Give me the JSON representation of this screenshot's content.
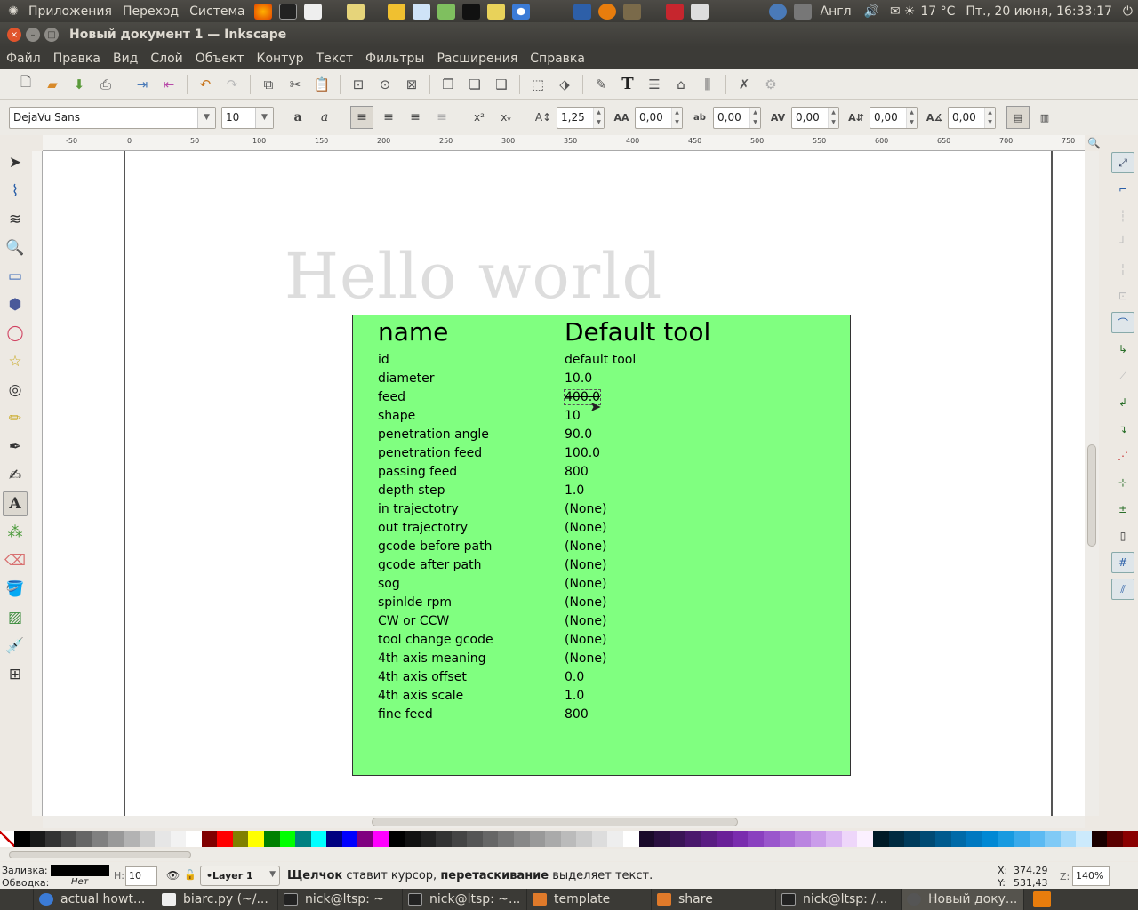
{
  "topbar": {
    "menus": [
      "Приложения",
      "Переход",
      "Система"
    ],
    "keyboard_layout": "Англ",
    "weather": "17 °C",
    "datetime": "Пт., 20 июня, 16:33:17"
  },
  "window": {
    "title": "Новый документ 1 — Inkscape"
  },
  "menubar": [
    "Файл",
    "Правка",
    "Вид",
    "Слой",
    "Объект",
    "Контур",
    "Текст",
    "Фильтры",
    "Расширения",
    "Справка"
  ],
  "textbar": {
    "font_family": "DejaVu Sans",
    "font_size": "10",
    "line_spacing": "1,25",
    "letter_spacing": "0,00",
    "word_spacing": "0,00",
    "kern_h": "0,00",
    "kern_v": "0,00",
    "rotation": "0,00"
  },
  "ruler_labels": [
    "-50",
    "0",
    "50",
    "100",
    "150",
    "200",
    "250",
    "300",
    "350",
    "400",
    "450",
    "500",
    "550",
    "600",
    "650",
    "700",
    "750"
  ],
  "canvas": {
    "hello_text": "Hello  world",
    "table_header_key": "name",
    "table_header_value": "Default tool",
    "rows": [
      {
        "k": "id",
        "v": "default tool"
      },
      {
        "k": "diameter",
        "v": "10.0"
      },
      {
        "k": "feed",
        "v": "400.0"
      },
      {
        "k": "shape",
        "v": "10"
      },
      {
        "k": "penetration angle",
        "v": "90.0"
      },
      {
        "k": "penetration feed",
        "v": "100.0"
      },
      {
        "k": "passing feed",
        "v": "800"
      },
      {
        "k": "depth step",
        "v": "1.0"
      },
      {
        "k": "in trajectotry",
        "v": "(None)"
      },
      {
        "k": "out trajectotry",
        "v": "(None)"
      },
      {
        "k": "gcode before path",
        "v": "(None)"
      },
      {
        "k": "gcode after path",
        "v": "(None)"
      },
      {
        "k": "sog",
        "v": "(None)"
      },
      {
        "k": "spinlde rpm",
        "v": "(None)"
      },
      {
        "k": "CW or CCW",
        "v": "(None)"
      },
      {
        "k": "tool change gcode",
        "v": "(None)"
      },
      {
        "k": "4th axis meaning",
        "v": "(None)"
      },
      {
        "k": "4th axis offset",
        "v": "0.0"
      },
      {
        "k": "4th axis scale",
        "v": "1.0"
      },
      {
        "k": "fine feed",
        "v": "800"
      }
    ]
  },
  "palette": [
    "#000000",
    "#1a1a1a",
    "#333333",
    "#4d4d4d",
    "#666666",
    "#808080",
    "#999999",
    "#b3b3b3",
    "#cccccc",
    "#e6e6e6",
    "#f2f2f2",
    "#ffffff",
    "#800000",
    "#ff0000",
    "#808000",
    "#ffff00",
    "#008000",
    "#00ff00",
    "#008080",
    "#00ffff",
    "#000080",
    "#0000ff",
    "#800080",
    "#ff00ff",
    "#000000",
    "#111111",
    "#222222",
    "#333333",
    "#444444",
    "#555555",
    "#666666",
    "#777777",
    "#888888",
    "#999999",
    "#aaaaaa",
    "#bbbbbb",
    "#cccccc",
    "#dddddd",
    "#eeeeee",
    "#ffffff",
    "#1a0a2a",
    "#2a1040",
    "#3a1456",
    "#4a186c",
    "#5a1c82",
    "#6a2098",
    "#7a2cae",
    "#8a40bf",
    "#9a56cc",
    "#aa6cd6",
    "#ba84e0",
    "#ca9cea",
    "#dab6f2",
    "#eed6fa",
    "#fbf0ff",
    "#001a26",
    "#002a40",
    "#003a5a",
    "#004a74",
    "#005a8e",
    "#006aa8",
    "#0078c0",
    "#0088d4",
    "#189ae0",
    "#3aaaeb",
    "#5cbaf2",
    "#80caf6",
    "#a6dafa",
    "#cceafc",
    "#1a0000",
    "#5a0000",
    "#8a0000"
  ],
  "status": {
    "fill_label": "Заливка:",
    "stroke_label": "Обводка:",
    "stroke_value": "Нет",
    "opacity_label": "H:",
    "opacity_value": "10",
    "layer": "•Layer 1",
    "message_bold1": "Щелчок",
    "message_1": " ставит курсор, ",
    "message_bold2": "перетаскивание",
    "message_2": " выделяет текст.",
    "x_label": "X:",
    "x_value": "374,29",
    "y_label": "Y:",
    "y_value": "531,43",
    "zoom_label": "Z:",
    "zoom_value": "140%"
  },
  "taskbar": [
    {
      "label": "actual howt..."
    },
    {
      "label": "biarc.py (~/..."
    },
    {
      "label": "nick@ltsp: ~"
    },
    {
      "label": "nick@ltsp: ~..."
    },
    {
      "label": "template"
    },
    {
      "label": "share"
    },
    {
      "label": "nick@ltsp: /..."
    },
    {
      "label": "Новый доку..."
    }
  ]
}
